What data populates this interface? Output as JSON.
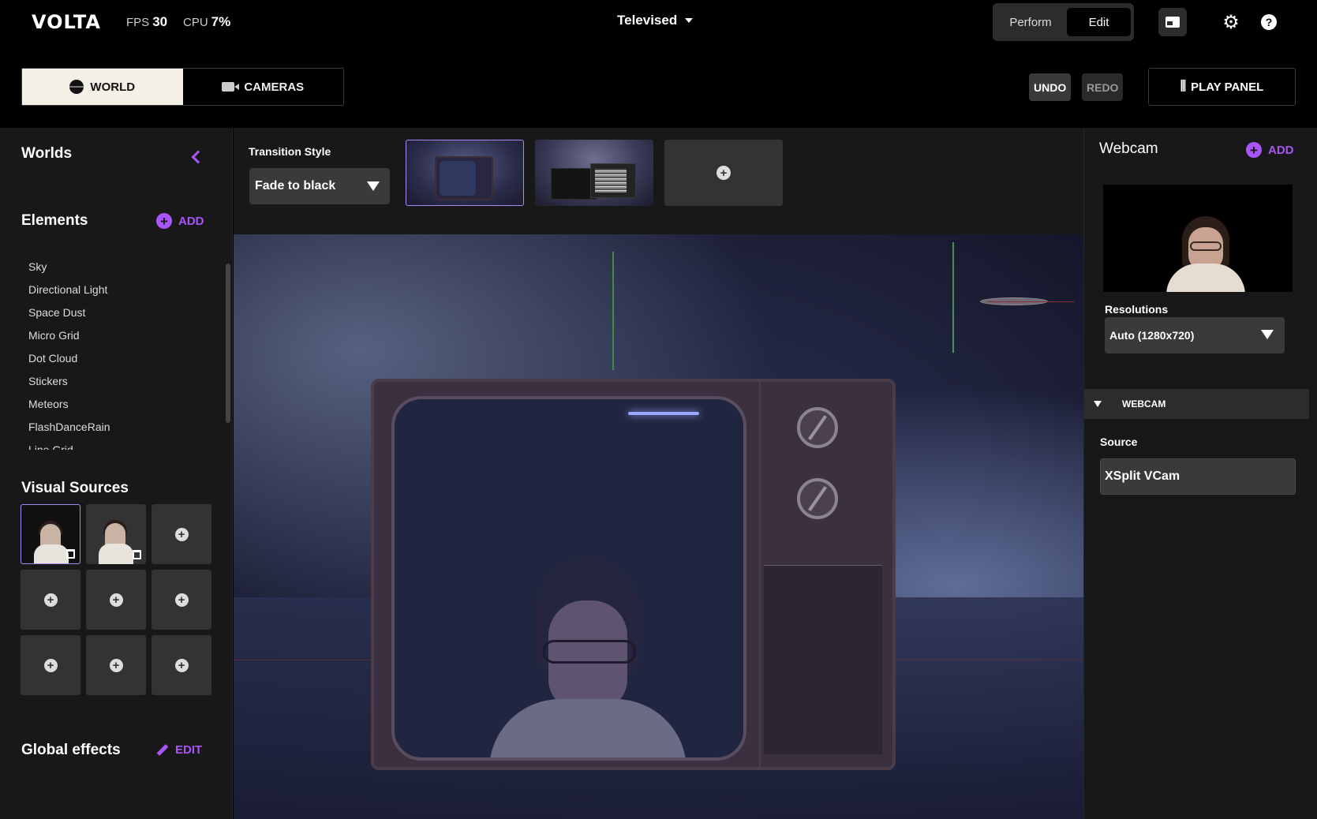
{
  "app": {
    "logo": "VOLTA",
    "fps_label": "FPS",
    "fps_value": "30",
    "cpu_label": "CPU",
    "cpu_value": "7%",
    "scene_name": "Televised",
    "modes": {
      "perform": "Perform",
      "edit": "Edit",
      "active": "Edit"
    },
    "icons": [
      "picture-in-picture-icon",
      "gear-icon",
      "help-icon"
    ]
  },
  "toolbar": {
    "tabs": [
      {
        "label": "WORLD",
        "icon": "globe-icon",
        "active": true
      },
      {
        "label": "CAMERAS",
        "icon": "camera-icon",
        "active": false
      }
    ],
    "undo": "UNDO",
    "redo": "REDO",
    "play_panel": "PLAY PANEL"
  },
  "left": {
    "worlds_title": "Worlds",
    "elements_title": "Elements",
    "elements_add": "ADD",
    "elements": [
      "Sky",
      "Directional Light",
      "Space Dust",
      "Micro Grid",
      "Dot Cloud",
      "Stickers",
      "Meteors",
      "FlashDanceRain",
      "Line Grid"
    ],
    "visual_sources_title": "Visual Sources",
    "global_effects_title": "Global effects",
    "global_effects_edit": "EDIT"
  },
  "center": {
    "transition_label": "Transition Style",
    "transition_value": "Fade to black"
  },
  "right": {
    "title": "Webcam",
    "add": "ADD",
    "resolutions_label": "Resolutions",
    "resolution_value": "Auto (1280x720)",
    "section_header": "WEBCAM",
    "source_label": "Source",
    "source_value": "XSplit VCam"
  },
  "colors": {
    "accent": "#a855f7",
    "background": "#000000",
    "panel": "#181818",
    "control": "#3a3a3a"
  }
}
